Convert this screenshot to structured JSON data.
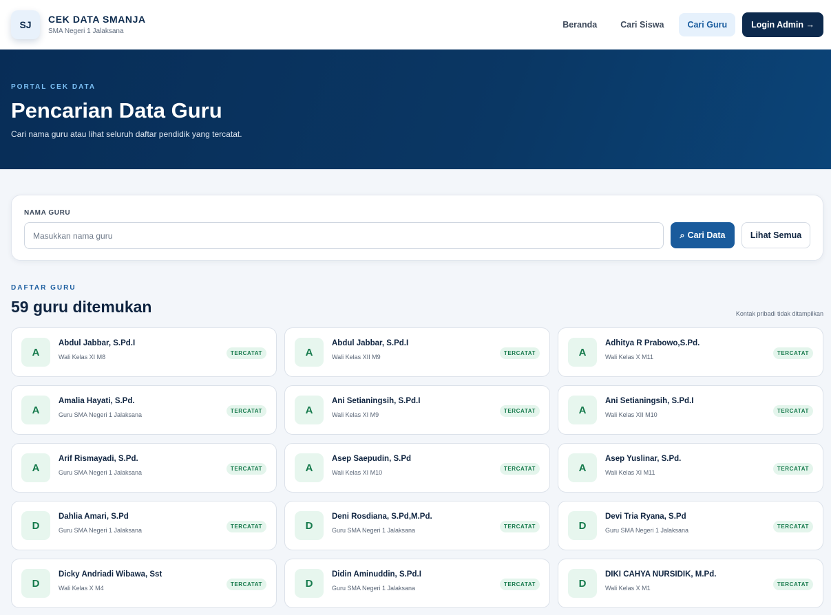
{
  "brand": {
    "logo": "SJ",
    "name": "CEK DATA SMANJA",
    "subtitle": "SMA Negeri 1 Jalaksana"
  },
  "nav": {
    "items": [
      "Beranda",
      "Cari Siswa",
      "Cari Guru"
    ],
    "active": "Cari Guru",
    "cta": "Login Admin →"
  },
  "hero": {
    "kicker": "PORTAL CEK DATA",
    "title": "Pencarian Data Guru",
    "description": "Cari nama guru atau lihat seluruh daftar pendidik yang tercatat."
  },
  "search": {
    "label": "NAMA GURU",
    "placeholder": "Masukkan nama guru",
    "search_icon": "⌕",
    "search_label": "Cari Data",
    "all_label": "Lihat Semua"
  },
  "list": {
    "kicker": "DAFTAR GURU",
    "count_title": "59 guru ditemukan",
    "privacy_note": "Kontak pribadi tidak ditampilkan",
    "badge": "TERCATAT"
  },
  "teachers": [
    {
      "initial": "A",
      "name": "Abdul Jabbar, S.Pd.I",
      "role": "Wali Kelas XI M8"
    },
    {
      "initial": "A",
      "name": "Abdul Jabbar, S.Pd.I",
      "role": "Wali Kelas XII M9"
    },
    {
      "initial": "A",
      "name": "Adhitya R Prabowo,S.Pd.",
      "role": "Wali Kelas X M11"
    },
    {
      "initial": "A",
      "name": "Amalia Hayati, S.Pd.",
      "role": "Guru SMA Negeri 1 Jalaksana"
    },
    {
      "initial": "A",
      "name": "Ani Setianingsih, S.Pd.I",
      "role": "Wali Kelas XI M9"
    },
    {
      "initial": "A",
      "name": "Ani Setianingsih, S.Pd.I",
      "role": "Wali Kelas XII M10"
    },
    {
      "initial": "A",
      "name": "Arif Rismayadi, S.Pd.",
      "role": "Guru SMA Negeri 1 Jalaksana"
    },
    {
      "initial": "A",
      "name": "Asep Saepudin, S.Pd",
      "role": "Wali Kelas XI M10"
    },
    {
      "initial": "A",
      "name": "Asep Yuslinar, S.Pd.",
      "role": "Wali Kelas XI M11"
    },
    {
      "initial": "D",
      "name": "Dahlia Amari, S.Pd",
      "role": "Guru SMA Negeri 1 Jalaksana"
    },
    {
      "initial": "D",
      "name": "Deni Rosdiana, S.Pd,M.Pd.",
      "role": "Guru SMA Negeri 1 Jalaksana"
    },
    {
      "initial": "D",
      "name": "Devi Tria Ryana, S.Pd",
      "role": "Guru SMA Negeri 1 Jalaksana"
    },
    {
      "initial": "D",
      "name": "Dicky Andriadi Wibawa, Sst",
      "role": "Wali Kelas X M4"
    },
    {
      "initial": "D",
      "name": "Didin Aminuddin, S.Pd.I",
      "role": "Guru SMA Negeri 1 Jalaksana"
    },
    {
      "initial": "D",
      "name": "DIKI CAHYA NURSIDIK, M.Pd.",
      "role": "Wali Kelas X M1"
    }
  ]
}
